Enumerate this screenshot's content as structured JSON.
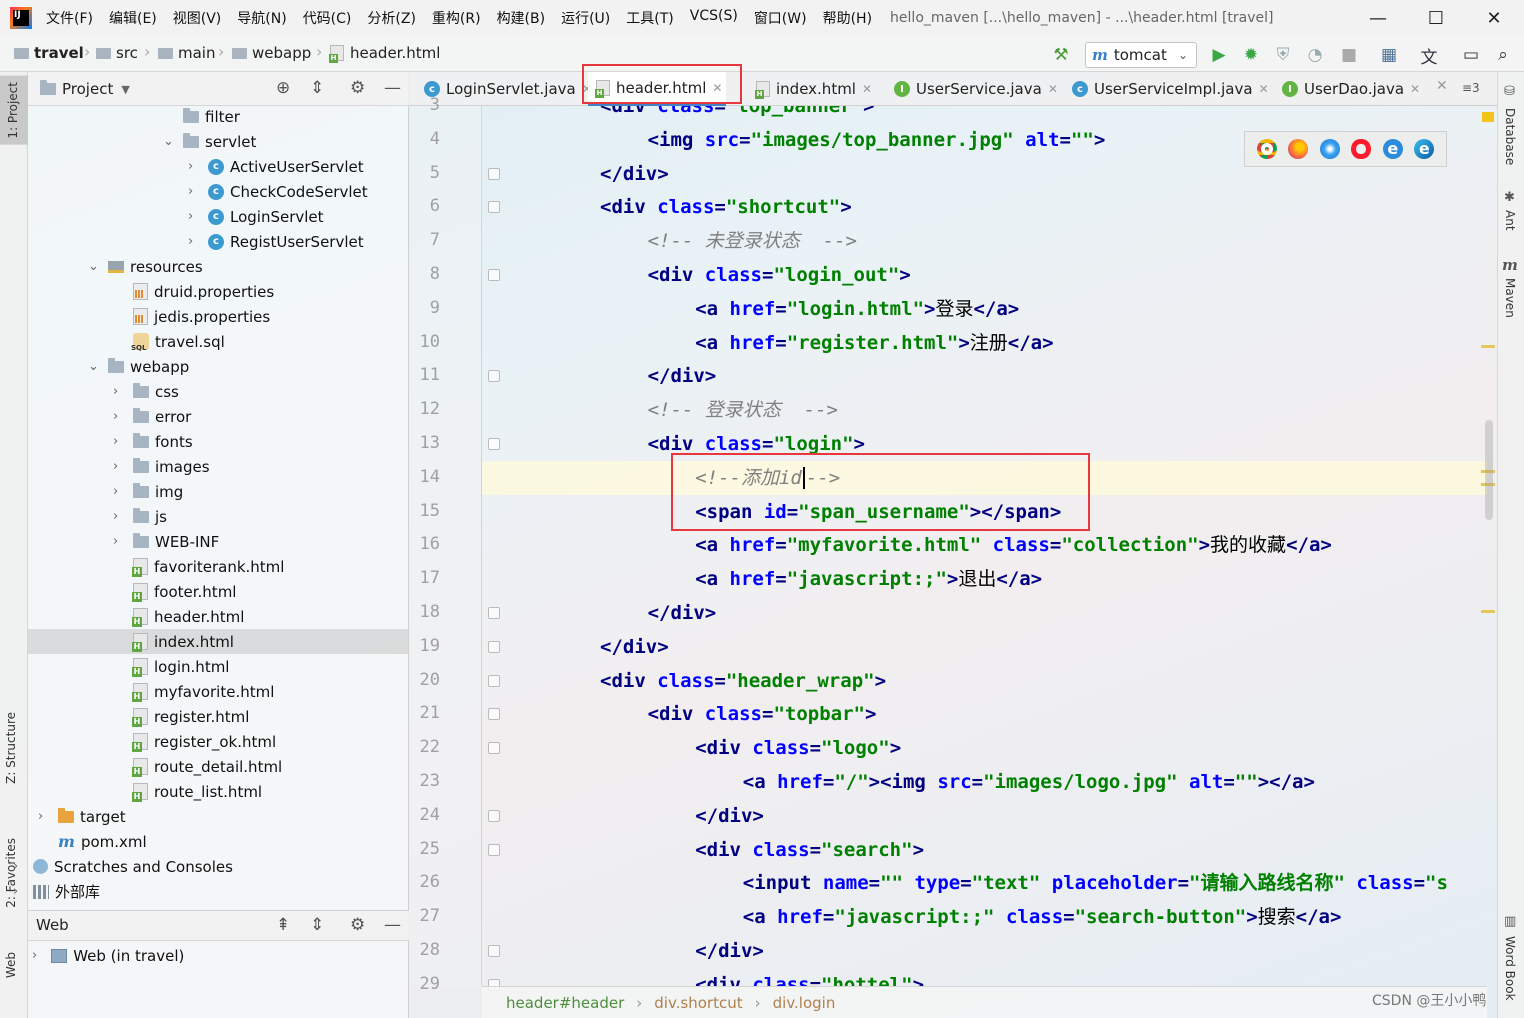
{
  "app": {
    "window_title": "hello_maven [...\\hello_maven] - ...\\header.html [travel]"
  },
  "menu": [
    "文件(F)",
    "编辑(E)",
    "视图(V)",
    "导航(N)",
    "代码(C)",
    "分析(Z)",
    "重构(R)",
    "构建(B)",
    "运行(U)",
    "工具(T)",
    "VCS(S)",
    "窗口(W)",
    "帮助(H)"
  ],
  "window_controls": {
    "minimize": "—",
    "maximize": "☐",
    "close": "✕"
  },
  "breadcrumbs": [
    "travel",
    "src",
    "main",
    "webapp",
    "header.html"
  ],
  "run_config": {
    "name": "tomcat"
  },
  "left_stripe": {
    "project_tab": "1: Project",
    "structure_tab": "Z: Structure",
    "favorites_tab": "2: Favorites",
    "web_tab": "Web"
  },
  "right_stripe": {
    "database_tab": "Database",
    "ant_tab": "Ant",
    "maven_tab": "Maven",
    "wordbook_tab": "Word Book"
  },
  "project_panel": {
    "title": "Project",
    "tree": [
      {
        "label": "filter",
        "icon": "folder",
        "depth": 7,
        "arrow": ""
      },
      {
        "label": "servlet",
        "icon": "folder",
        "depth": 7,
        "arrow": "open"
      },
      {
        "label": "ActiveUserServlet",
        "icon": "class",
        "depth": 8,
        "arrow": "closed"
      },
      {
        "label": "CheckCodeServlet",
        "icon": "class",
        "depth": 8,
        "arrow": "closed"
      },
      {
        "label": "LoginServlet",
        "icon": "class",
        "depth": 8,
        "arrow": "closed"
      },
      {
        "label": "RegistUserServlet",
        "icon": "class",
        "depth": 8,
        "arrow": "closed"
      },
      {
        "label": "resources",
        "icon": "resources",
        "depth": 4,
        "arrow": "open"
      },
      {
        "label": "druid.properties",
        "icon": "props",
        "depth": 5,
        "arrow": ""
      },
      {
        "label": "jedis.properties",
        "icon": "props",
        "depth": 5,
        "arrow": ""
      },
      {
        "label": "travel.sql",
        "icon": "sql",
        "depth": 5,
        "arrow": ""
      },
      {
        "label": "webapp",
        "icon": "folder",
        "depth": 4,
        "arrow": "open"
      },
      {
        "label": "css",
        "icon": "folder",
        "depth": 5,
        "arrow": "closed"
      },
      {
        "label": "error",
        "icon": "folder",
        "depth": 5,
        "arrow": "closed"
      },
      {
        "label": "fonts",
        "icon": "folder",
        "depth": 5,
        "arrow": "closed"
      },
      {
        "label": "images",
        "icon": "folder",
        "depth": 5,
        "arrow": "closed"
      },
      {
        "label": "img",
        "icon": "folder",
        "depth": 5,
        "arrow": "closed"
      },
      {
        "label": "js",
        "icon": "folder",
        "depth": 5,
        "arrow": "closed"
      },
      {
        "label": "WEB-INF",
        "icon": "folder",
        "depth": 5,
        "arrow": "closed"
      },
      {
        "label": "favoriterank.html",
        "icon": "html",
        "depth": 5,
        "arrow": ""
      },
      {
        "label": "footer.html",
        "icon": "html",
        "depth": 5,
        "arrow": ""
      },
      {
        "label": "header.html",
        "icon": "html",
        "depth": 5,
        "arrow": ""
      },
      {
        "label": "index.html",
        "icon": "html",
        "depth": 5,
        "arrow": "",
        "selected": true
      },
      {
        "label": "login.html",
        "icon": "html",
        "depth": 5,
        "arrow": ""
      },
      {
        "label": "myfavorite.html",
        "icon": "html",
        "depth": 5,
        "arrow": ""
      },
      {
        "label": "register.html",
        "icon": "html",
        "depth": 5,
        "arrow": ""
      },
      {
        "label": "register_ok.html",
        "icon": "html",
        "depth": 5,
        "arrow": ""
      },
      {
        "label": "route_detail.html",
        "icon": "html",
        "depth": 5,
        "arrow": ""
      },
      {
        "label": "route_list.html",
        "icon": "html",
        "depth": 5,
        "arrow": ""
      },
      {
        "label": "target",
        "icon": "folder-orange",
        "depth": 2,
        "arrow": "closed"
      },
      {
        "label": "pom.xml",
        "icon": "maven",
        "depth": 2,
        "arrow": ""
      },
      {
        "label": "Scratches and Consoles",
        "icon": "scratch",
        "depth": 1,
        "arrow": "closed"
      },
      {
        "label": "外部库",
        "icon": "lib",
        "depth": 1,
        "arrow": "closed"
      }
    ]
  },
  "web_panel": {
    "title": "Web",
    "item": "Web (in travel)"
  },
  "tabs": [
    {
      "label": "LoginServlet.java",
      "icon": "java"
    },
    {
      "label": "header.html",
      "icon": "html",
      "active": true
    },
    {
      "label": "index.html",
      "icon": "html"
    },
    {
      "label": "UserService.java",
      "icon": "interface"
    },
    {
      "label": "UserServiceImpl.java",
      "icon": "java"
    },
    {
      "label": "UserDao.java",
      "icon": "interface"
    }
  ],
  "tab_overflow": "≡3",
  "editor": {
    "current_line": 14,
    "lines": [
      {
        "n": "3",
        "indent": 0,
        "seg": [
          [
            "tag",
            "<div "
          ],
          [
            "attr",
            "class"
          ],
          [
            "tag",
            "="
          ],
          [
            "val",
            "\"top_banner\""
          ],
          [
            "tag",
            ">"
          ]
        ]
      },
      {
        "n": "4",
        "indent": 1,
        "seg": [
          [
            "tag",
            "<img "
          ],
          [
            "attr",
            "src"
          ],
          [
            "tag",
            "="
          ],
          [
            "val",
            "\"images/top_banner.jpg\""
          ],
          [
            "tag",
            " "
          ],
          [
            "attr",
            "alt"
          ],
          [
            "tag",
            "="
          ],
          [
            "val",
            "\"\""
          ],
          [
            "tag",
            ">"
          ]
        ]
      },
      {
        "n": "5",
        "indent": 0,
        "seg": [
          [
            "tag",
            "</div>"
          ]
        ]
      },
      {
        "n": "6",
        "indent": 0,
        "seg": [
          [
            "tag",
            "<div "
          ],
          [
            "attr",
            "class"
          ],
          [
            "tag",
            "="
          ],
          [
            "val",
            "\"shortcut\""
          ],
          [
            "tag",
            ">"
          ]
        ]
      },
      {
        "n": "7",
        "indent": 1,
        "seg": [
          [
            "cmt",
            "<!-- 未登录状态  -->"
          ]
        ]
      },
      {
        "n": "8",
        "indent": 1,
        "seg": [
          [
            "tag",
            "<div "
          ],
          [
            "attr",
            "class"
          ],
          [
            "tag",
            "="
          ],
          [
            "val",
            "\"login_out\""
          ],
          [
            "tag",
            ">"
          ]
        ]
      },
      {
        "n": "9",
        "indent": 2,
        "seg": [
          [
            "tag",
            "<a "
          ],
          [
            "attr",
            "href"
          ],
          [
            "tag",
            "="
          ],
          [
            "val",
            "\"login.html\""
          ],
          [
            "tag",
            ">"
          ],
          [
            "txt",
            "登录"
          ],
          [
            "tag",
            "</a>"
          ]
        ]
      },
      {
        "n": "10",
        "indent": 2,
        "seg": [
          [
            "tag",
            "<a "
          ],
          [
            "attr",
            "href"
          ],
          [
            "tag",
            "="
          ],
          [
            "val",
            "\"register.html\""
          ],
          [
            "tag",
            ">"
          ],
          [
            "txt",
            "注册"
          ],
          [
            "tag",
            "</a>"
          ]
        ]
      },
      {
        "n": "11",
        "indent": 1,
        "seg": [
          [
            "tag",
            "</div>"
          ]
        ]
      },
      {
        "n": "12",
        "indent": 1,
        "seg": [
          [
            "cmt",
            "<!-- 登录状态  -->"
          ]
        ]
      },
      {
        "n": "13",
        "indent": 1,
        "seg": [
          [
            "tag",
            "<div "
          ],
          [
            "attr",
            "class"
          ],
          [
            "tag",
            "="
          ],
          [
            "val",
            "\"login\""
          ],
          [
            "tag",
            ">"
          ]
        ]
      },
      {
        "n": "14",
        "indent": 2,
        "seg": [
          [
            "cmt",
            "<!--添加id"
          ],
          [
            "caret",
            ""
          ],
          [
            "cmt",
            "-->"
          ]
        ]
      },
      {
        "n": "15",
        "indent": 2,
        "seg": [
          [
            "tag",
            "<span "
          ],
          [
            "attr",
            "id"
          ],
          [
            "tag",
            "="
          ],
          [
            "val",
            "\"span_username\""
          ],
          [
            "tag",
            "></span>"
          ]
        ]
      },
      {
        "n": "16",
        "indent": 2,
        "seg": [
          [
            "tag",
            "<a "
          ],
          [
            "attr",
            "href"
          ],
          [
            "tag",
            "="
          ],
          [
            "val",
            "\"myfavorite.html\""
          ],
          [
            "tag",
            " "
          ],
          [
            "attr",
            "class"
          ],
          [
            "tag",
            "="
          ],
          [
            "val",
            "\"collection\""
          ],
          [
            "tag",
            ">"
          ],
          [
            "txt",
            "我的收藏"
          ],
          [
            "tag",
            "</a>"
          ]
        ]
      },
      {
        "n": "17",
        "indent": 2,
        "seg": [
          [
            "tag",
            "<a "
          ],
          [
            "attr",
            "href"
          ],
          [
            "tag",
            "="
          ],
          [
            "val",
            "\"javascript:;\""
          ],
          [
            "tag",
            ">"
          ],
          [
            "txt",
            "退出"
          ],
          [
            "tag",
            "</a>"
          ]
        ]
      },
      {
        "n": "18",
        "indent": 1,
        "seg": [
          [
            "tag",
            "</div>"
          ]
        ]
      },
      {
        "n": "19",
        "indent": 0,
        "seg": [
          [
            "tag",
            "</div>"
          ]
        ]
      },
      {
        "n": "20",
        "indent": 0,
        "seg": [
          [
            "tag",
            "<div "
          ],
          [
            "attr",
            "class"
          ],
          [
            "tag",
            "="
          ],
          [
            "val",
            "\"header_wrap\""
          ],
          [
            "tag",
            ">"
          ]
        ]
      },
      {
        "n": "21",
        "indent": 1,
        "seg": [
          [
            "tag",
            "<div "
          ],
          [
            "attr",
            "class"
          ],
          [
            "tag",
            "="
          ],
          [
            "val",
            "\"topbar\""
          ],
          [
            "tag",
            ">"
          ]
        ]
      },
      {
        "n": "22",
        "indent": 2,
        "seg": [
          [
            "tag",
            "<div "
          ],
          [
            "attr",
            "class"
          ],
          [
            "tag",
            "="
          ],
          [
            "val",
            "\"logo\""
          ],
          [
            "tag",
            ">"
          ]
        ]
      },
      {
        "n": "23",
        "indent": 3,
        "seg": [
          [
            "tag",
            "<a "
          ],
          [
            "attr",
            "href"
          ],
          [
            "tag",
            "="
          ],
          [
            "val",
            "\"/\""
          ],
          [
            "tag",
            "><img "
          ],
          [
            "attr",
            "src"
          ],
          [
            "tag",
            "="
          ],
          [
            "val",
            "\"images/logo.jpg\""
          ],
          [
            "tag",
            " "
          ],
          [
            "attr",
            "alt"
          ],
          [
            "tag",
            "="
          ],
          [
            "val",
            "\"\""
          ],
          [
            "tag",
            "></a>"
          ]
        ]
      },
      {
        "n": "24",
        "indent": 2,
        "seg": [
          [
            "tag",
            "</div>"
          ]
        ]
      },
      {
        "n": "25",
        "indent": 2,
        "seg": [
          [
            "tag",
            "<div "
          ],
          [
            "attr",
            "class"
          ],
          [
            "tag",
            "="
          ],
          [
            "val",
            "\"search\""
          ],
          [
            "tag",
            ">"
          ]
        ]
      },
      {
        "n": "26",
        "indent": 3,
        "seg": [
          [
            "tag",
            "<input "
          ],
          [
            "attr",
            "name"
          ],
          [
            "tag",
            "="
          ],
          [
            "val",
            "\"\""
          ],
          [
            "tag",
            " "
          ],
          [
            "attr",
            "type"
          ],
          [
            "tag",
            "="
          ],
          [
            "val",
            "\"text\""
          ],
          [
            "tag",
            " "
          ],
          [
            "attr",
            "placeholder"
          ],
          [
            "tag",
            "="
          ],
          [
            "val",
            "\"请输入路线名称\""
          ],
          [
            "tag",
            " "
          ],
          [
            "attr",
            "class"
          ],
          [
            "tag",
            "="
          ],
          [
            "val",
            "\"s"
          ]
        ]
      },
      {
        "n": "27",
        "indent": 3,
        "seg": [
          [
            "tag",
            "<a "
          ],
          [
            "attr",
            "href"
          ],
          [
            "tag",
            "="
          ],
          [
            "val",
            "\"javascript:;\""
          ],
          [
            "tag",
            " "
          ],
          [
            "attr",
            "class"
          ],
          [
            "tag",
            "="
          ],
          [
            "val",
            "\"search-button\""
          ],
          [
            "tag",
            ">"
          ],
          [
            "txt",
            "搜索"
          ],
          [
            "tag",
            "</a>"
          ]
        ]
      },
      {
        "n": "28",
        "indent": 2,
        "seg": [
          [
            "tag",
            "</div>"
          ]
        ]
      },
      {
        "n": "29",
        "indent": 2,
        "seg": [
          [
            "tag",
            "<div "
          ],
          [
            "attr",
            "class"
          ],
          [
            "tag",
            "="
          ],
          [
            "val",
            "\"hottel\""
          ],
          [
            "tag",
            ">"
          ]
        ]
      }
    ]
  },
  "editor_breadcrumb": [
    "header#header",
    "div.shortcut",
    "div.login"
  ],
  "browsers": [
    "chrome",
    "firefox",
    "safari",
    "opera",
    "ie",
    "edge"
  ],
  "watermark": "CSDN @王小小鸭"
}
